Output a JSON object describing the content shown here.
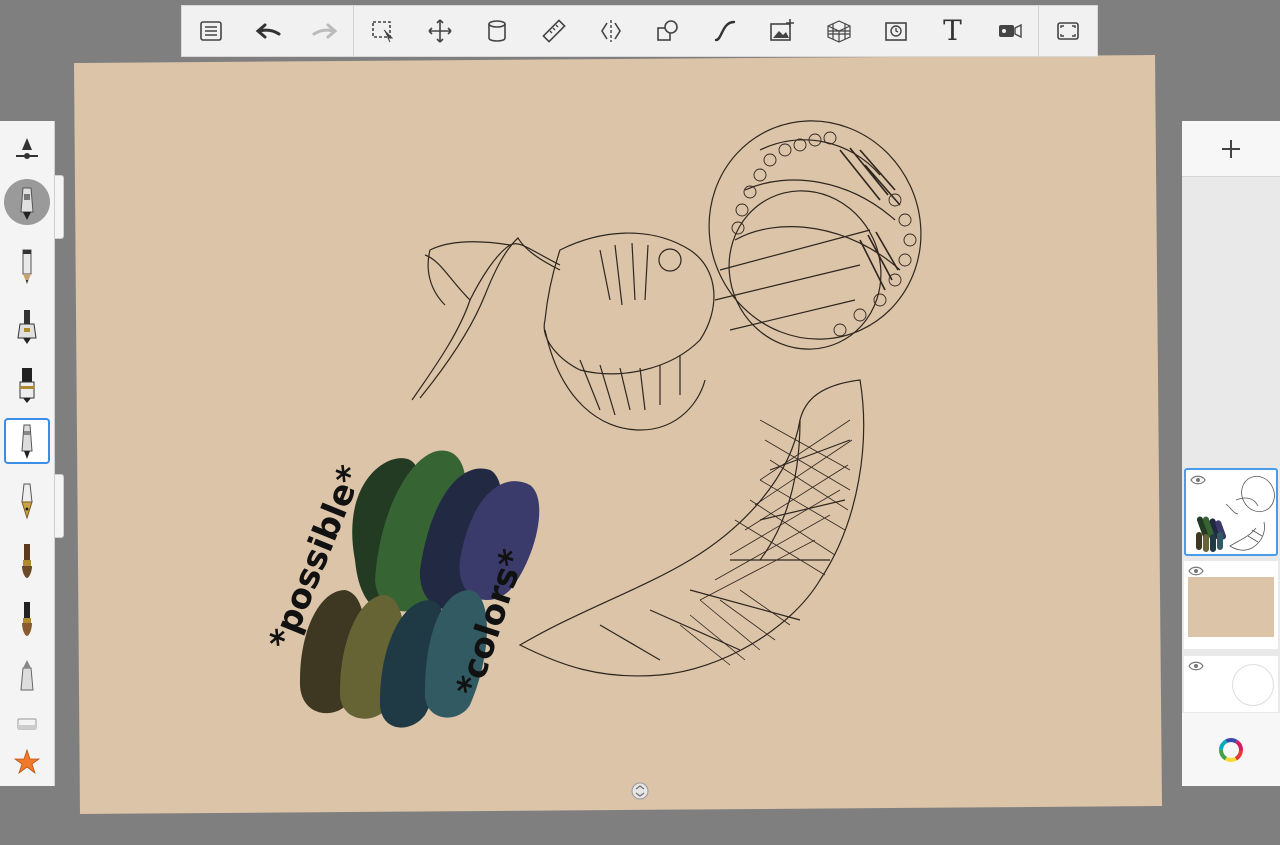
{
  "app": {
    "toolbar": {
      "tools": [
        {
          "name": "menu-icon"
        },
        {
          "name": "undo-icon"
        },
        {
          "name": "redo-icon"
        },
        {
          "name": "selection-icon"
        },
        {
          "name": "transform-icon"
        },
        {
          "name": "fill-bucket-icon"
        },
        {
          "name": "ruler-icon"
        },
        {
          "name": "symmetry-icon"
        },
        {
          "name": "shapes-icon"
        },
        {
          "name": "stroke-curve-icon"
        },
        {
          "name": "add-image-icon"
        },
        {
          "name": "perspective-grid-icon"
        },
        {
          "name": "time-lapse-icon"
        },
        {
          "name": "text-tool-icon",
          "label": "T"
        },
        {
          "name": "record-video-icon"
        },
        {
          "name": "fullscreen-icon"
        }
      ]
    },
    "canvas": {
      "paper_color": "#dcc4a8",
      "annotation_left": "*possible*",
      "annotation_right": "*colors*",
      "swatches": [
        "#223b22",
        "#376433",
        "#212a42",
        "#3b3b6b",
        "#3e3822",
        "#666335",
        "#1f3a44",
        "#325a63"
      ]
    },
    "brushes": [
      {
        "name": "brush-size-slider-icon"
      },
      {
        "name": "airbrush-brush-icon",
        "state": "active"
      },
      {
        "name": "pencil-brush-icon"
      },
      {
        "name": "ballpoint-brush-icon"
      },
      {
        "name": "marker-brush-icon"
      },
      {
        "name": "fineliner-brush-icon",
        "state": "selected"
      },
      {
        "name": "fountain-pen-brush-icon"
      },
      {
        "name": "paint-brush-icon"
      },
      {
        "name": "ink-brush-icon"
      },
      {
        "name": "chisel-brush-icon"
      },
      {
        "name": "eraser-brush-icon"
      },
      {
        "name": "favorites-star-icon"
      }
    ],
    "layers": [
      {
        "name": "layer-sketch",
        "selected": true
      },
      {
        "name": "layer-paper-color",
        "fill": "#dcc4a8"
      },
      {
        "name": "layer-background",
        "fill": "#ffffff"
      }
    ],
    "colors": {
      "accent": "#3a8ee6",
      "star": "#f07a2a"
    }
  }
}
